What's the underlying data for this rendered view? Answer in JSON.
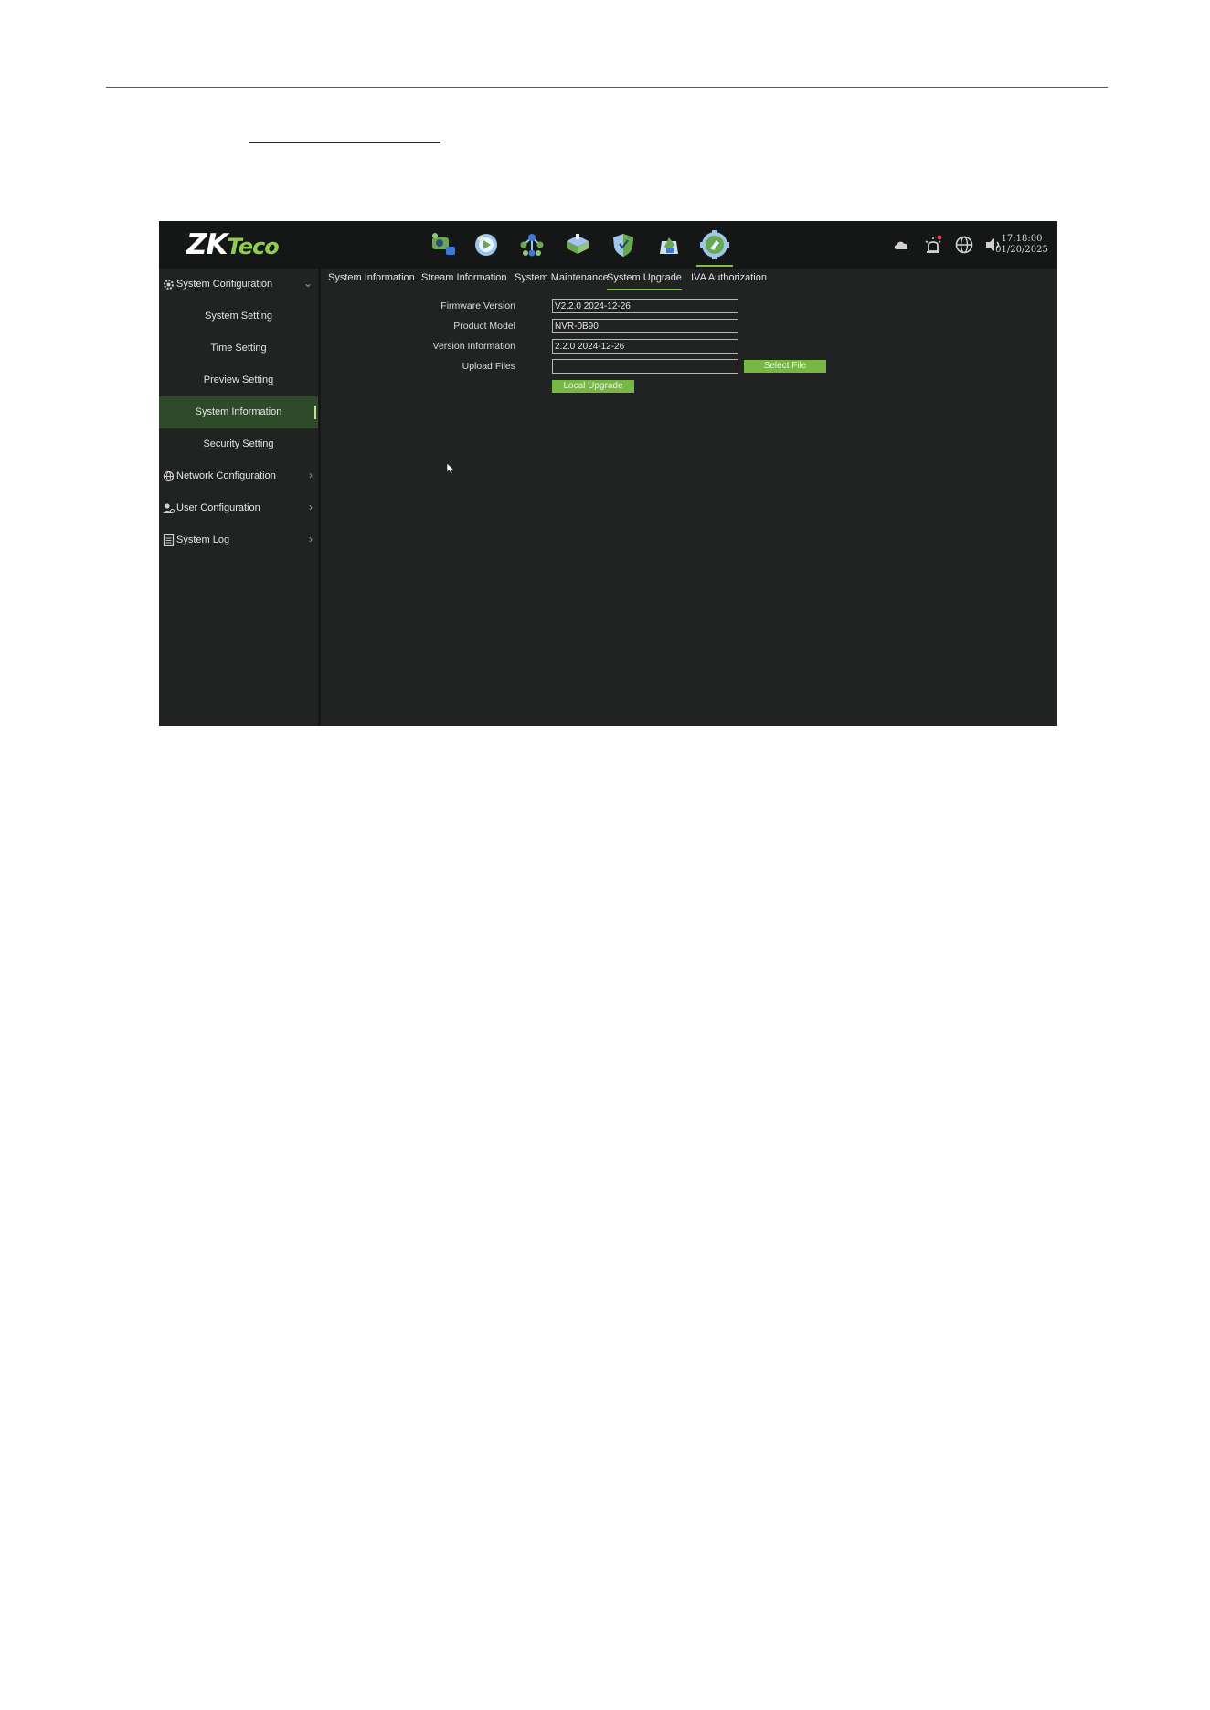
{
  "app": {
    "logo_main": "ZK",
    "logo_accent": "Teco",
    "clock_time": "17:18:00",
    "clock_date": "01/20/2025",
    "accent_color": "#7fc24a"
  },
  "top_modules": [
    {
      "name": "camera-icon"
    },
    {
      "name": "playback-icon"
    },
    {
      "name": "network-topology-icon"
    },
    {
      "name": "storage-icon"
    },
    {
      "name": "shield-icon"
    },
    {
      "name": "smart-icon"
    },
    {
      "name": "settings-icon",
      "active": true
    }
  ],
  "status_icons": [
    "cloud-icon",
    "alarm-icon",
    "globe-icon",
    "volume-icon"
  ],
  "sidebar": {
    "groups": [
      {
        "label": "System Configuration",
        "icon": "gear-icon",
        "expanded": true
      },
      {
        "label": "Network Configuration",
        "icon": "network-globe-icon"
      },
      {
        "label": "User Configuration",
        "icon": "user-icon"
      },
      {
        "label": "System Log",
        "icon": "log-icon"
      }
    ],
    "items": [
      {
        "label": "System Setting"
      },
      {
        "label": "Time Setting"
      },
      {
        "label": "Preview Setting"
      },
      {
        "label": "System Information",
        "active": true
      },
      {
        "label": "Security Setting"
      }
    ]
  },
  "tabs": [
    {
      "label": "System Information"
    },
    {
      "label": "Stream Information"
    },
    {
      "label": "System Maintenance"
    },
    {
      "label": "System Upgrade",
      "active": true
    },
    {
      "label": "IVA Authorization"
    }
  ],
  "form": {
    "firmware_label": "Firmware Version",
    "firmware_value": "V2.2.0 2024-12-26",
    "model_label": "Product Model",
    "model_value": "NVR-0B90",
    "version_label": "Version Information",
    "version_value": "2.2.0 2024-12-26",
    "upload_label": "Upload Files",
    "upload_value": "",
    "select_file_label": "Select File",
    "local_upgrade_label": "Local Upgrade"
  }
}
